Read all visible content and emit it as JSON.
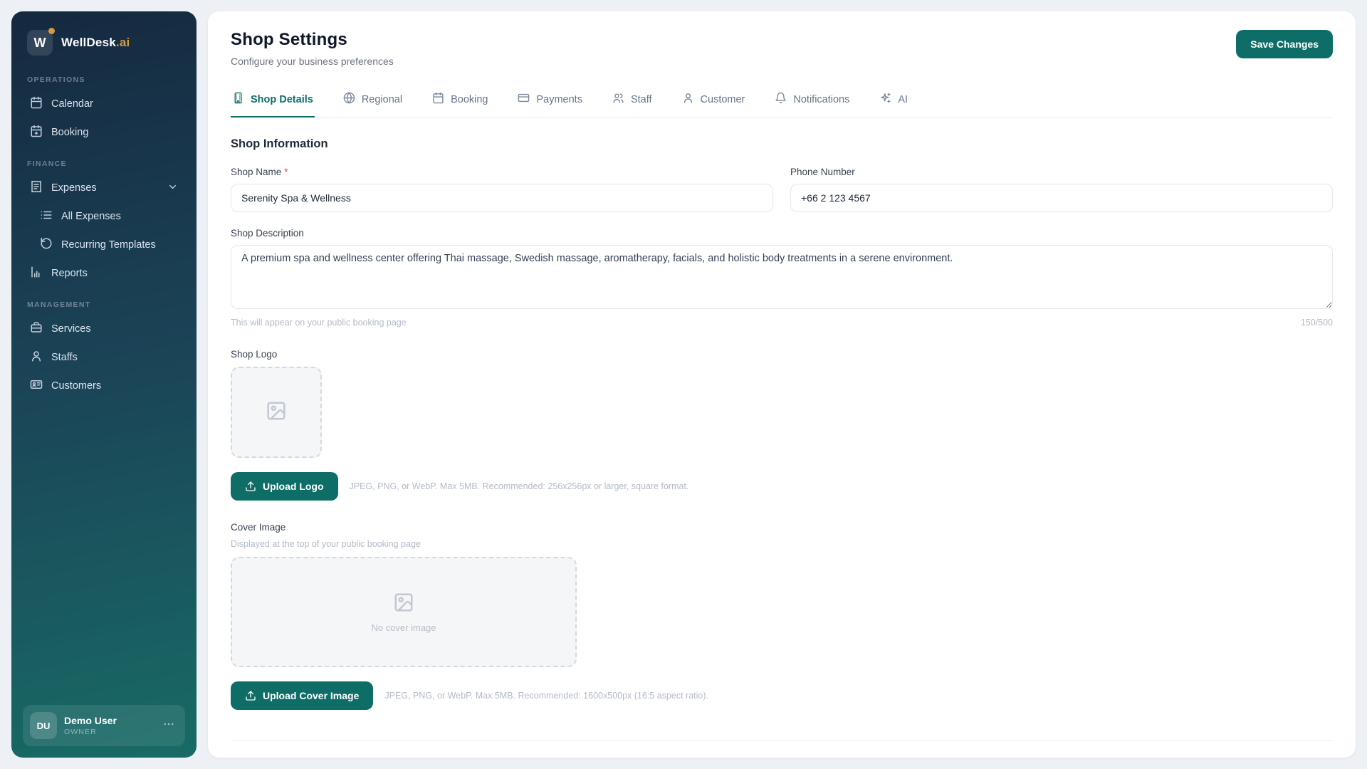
{
  "brand": {
    "logo_letter": "W",
    "name": "WellDesk",
    "suffix": ".ai"
  },
  "sidebar": {
    "sections": [
      {
        "label": "OPERATIONS",
        "items": [
          {
            "label": "Calendar"
          },
          {
            "label": "Booking"
          }
        ]
      },
      {
        "label": "FINANCE",
        "items": [
          {
            "label": "Expenses"
          },
          {
            "label": "All Expenses"
          },
          {
            "label": "Recurring Templates"
          },
          {
            "label": "Reports"
          }
        ]
      },
      {
        "label": "MANAGEMENT",
        "items": [
          {
            "label": "Services"
          },
          {
            "label": "Staffs"
          },
          {
            "label": "Customers"
          }
        ]
      }
    ],
    "user": {
      "initials": "DU",
      "name": "Demo User",
      "role": "OWNER",
      "menu": "..."
    }
  },
  "header": {
    "title": "Shop Settings",
    "subtitle": "Configure your business preferences",
    "save_button": "Save Changes"
  },
  "tabs": {
    "active": "Shop Details",
    "items": [
      {
        "label": "Shop Details"
      },
      {
        "label": "Regional"
      },
      {
        "label": "Booking"
      },
      {
        "label": "Payments"
      },
      {
        "label": "Staff"
      },
      {
        "label": "Customer"
      },
      {
        "label": "Notifications"
      },
      {
        "label": "AI"
      }
    ]
  },
  "form": {
    "section_title": "Shop Information",
    "shop_name": {
      "label": "Shop Name",
      "required_mark": "*",
      "value": "Serenity Spa & Wellness"
    },
    "phone": {
      "label": "Phone Number",
      "value": "+66 2 123 4567"
    },
    "description": {
      "label": "Shop Description",
      "value": "A premium spa and wellness center offering Thai massage, Swedish massage, aromatherapy, facials, and holistic body treatments in a serene environment.",
      "helper": "This will appear on your public booking page",
      "counter": "150/500"
    },
    "logo": {
      "label": "Shop Logo",
      "button": "Upload Logo",
      "helper": "JPEG, PNG, or WebP. Max 5MB. Recommended: 256x256px or larger, square format."
    },
    "cover": {
      "label": "Cover Image",
      "sublabel": "Displayed at the top of your public booking page",
      "empty_text": "No cover image",
      "button": "Upload Cover Image",
      "helper": "JPEG, PNG, or WebP. Max 5MB. Recommended: 1600x500px (16:5 aspect ratio)."
    }
  },
  "colors": {
    "accent": "#0e6e67",
    "brand_accent": "#d79b3e",
    "sidebar_top": "#152940",
    "sidebar_bottom": "#186b66"
  }
}
